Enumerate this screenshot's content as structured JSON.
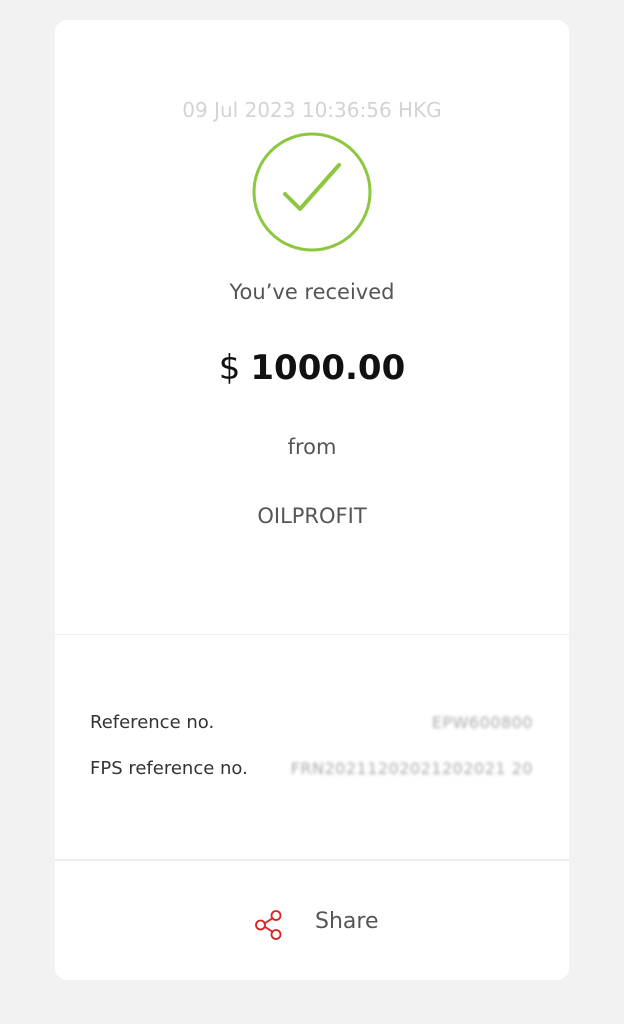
{
  "receipt": {
    "timestamp": "09 Jul 2023 10:36:56 HKG",
    "status_icon": "checkmark-circle-icon",
    "received_text": "You’ve received",
    "currency_symbol": "$",
    "amount": "1000.00",
    "from_text": "from",
    "payer_name": "OILPROFIT"
  },
  "details": {
    "reference_label": "Reference no.",
    "reference_value": "EPW600800",
    "fps_reference_label": "FPS reference no.",
    "fps_reference_value": "FRN20211202021202021 20"
  },
  "actions": {
    "share_label": "Share",
    "share_icon": "share-icon"
  },
  "colors": {
    "success_green": "#8dc63f",
    "share_red": "#e02020",
    "background": "#f2f2f2"
  }
}
